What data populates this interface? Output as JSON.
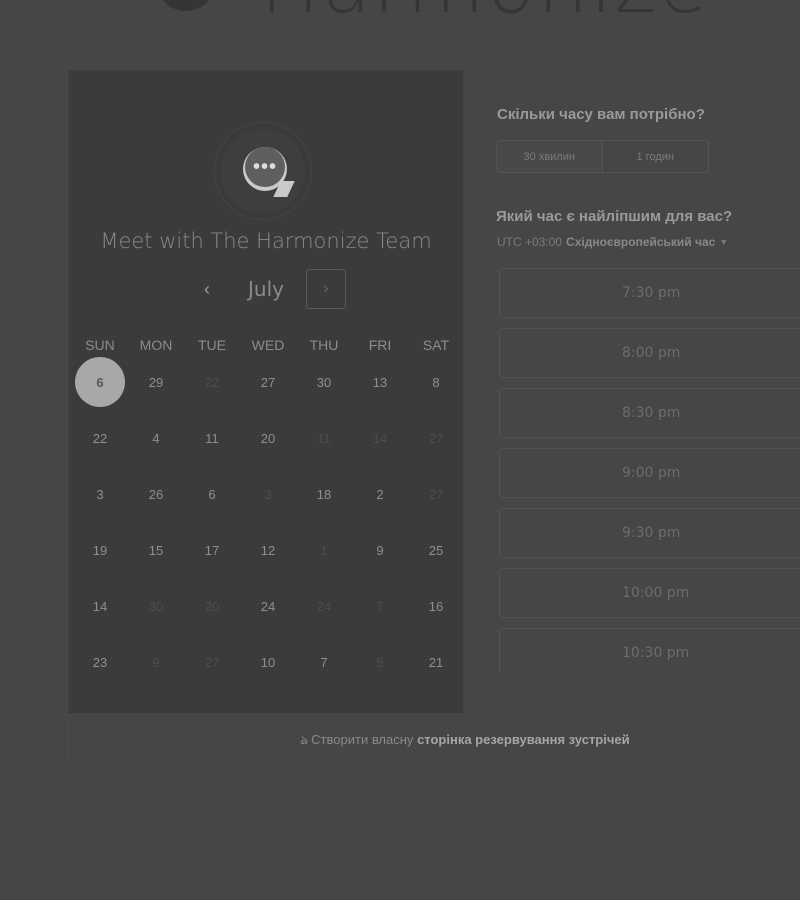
{
  "brand": {
    "name": "Harmonize",
    "logo_icon": "harmonize-logo-icon"
  },
  "calendar": {
    "meeting_title": "Meet with The Harmonize Team",
    "month": "July",
    "prev_icon": "chevron-left-icon",
    "next_icon": "chevron-right-icon",
    "weekdays": [
      "SUN",
      "MON",
      "TUE",
      "WED",
      "THU",
      "FRI",
      "SAT"
    ],
    "days": [
      {
        "label": "6",
        "state": "selected"
      },
      {
        "label": "29",
        "state": "available"
      },
      {
        "label": "22",
        "state": "disabled"
      },
      {
        "label": "27",
        "state": "available"
      },
      {
        "label": "30",
        "state": "available"
      },
      {
        "label": "13",
        "state": "available"
      },
      {
        "label": "8",
        "state": "available"
      },
      {
        "label": "22",
        "state": "available"
      },
      {
        "label": "4",
        "state": "available"
      },
      {
        "label": "11",
        "state": "available"
      },
      {
        "label": "20",
        "state": "available"
      },
      {
        "label": "11",
        "state": "disabled"
      },
      {
        "label": "14",
        "state": "disabled"
      },
      {
        "label": "27",
        "state": "disabled"
      },
      {
        "label": "3",
        "state": "available"
      },
      {
        "label": "26",
        "state": "available"
      },
      {
        "label": "6",
        "state": "available"
      },
      {
        "label": "3",
        "state": "disabled"
      },
      {
        "label": "18",
        "state": "available"
      },
      {
        "label": "2",
        "state": "available"
      },
      {
        "label": "27",
        "state": "disabled"
      },
      {
        "label": "19",
        "state": "available"
      },
      {
        "label": "15",
        "state": "available"
      },
      {
        "label": "17",
        "state": "available"
      },
      {
        "label": "12",
        "state": "available"
      },
      {
        "label": "1",
        "state": "disabled"
      },
      {
        "label": "9",
        "state": "available"
      },
      {
        "label": "25",
        "state": "available"
      },
      {
        "label": "14",
        "state": "available"
      },
      {
        "label": "30",
        "state": "disabled"
      },
      {
        "label": "20",
        "state": "disabled"
      },
      {
        "label": "24",
        "state": "available"
      },
      {
        "label": "24",
        "state": "disabled"
      },
      {
        "label": "7",
        "state": "disabled"
      },
      {
        "label": "16",
        "state": "available"
      },
      {
        "label": "23",
        "state": "available"
      },
      {
        "label": "9",
        "state": "disabled"
      },
      {
        "label": "27",
        "state": "disabled"
      },
      {
        "label": "10",
        "state": "available"
      },
      {
        "label": "7",
        "state": "available"
      },
      {
        "label": "5",
        "state": "disabled"
      },
      {
        "label": "21",
        "state": "available"
      }
    ]
  },
  "scheduler": {
    "duration_question": "Скільки часу вам потрібно?",
    "duration_options": [
      "30 хвилин",
      "1 годин"
    ],
    "time_question": "Який час є найліпшим для вас?",
    "timezone_offset": "UTC +03:00",
    "timezone_name": "Східноєвропейський час",
    "timezone_icon": "caret-down-icon",
    "time_slots": [
      "7:30 pm",
      "8:00 pm",
      "8:30 pm",
      "9:00 pm",
      "9:30 pm",
      "10:00 pm",
      "10:30 pm"
    ]
  },
  "footer": {
    "icon": "hubspot-sprocket-icon",
    "prefix": "Створити власну",
    "link": "сторінка резервування зустрічей"
  }
}
